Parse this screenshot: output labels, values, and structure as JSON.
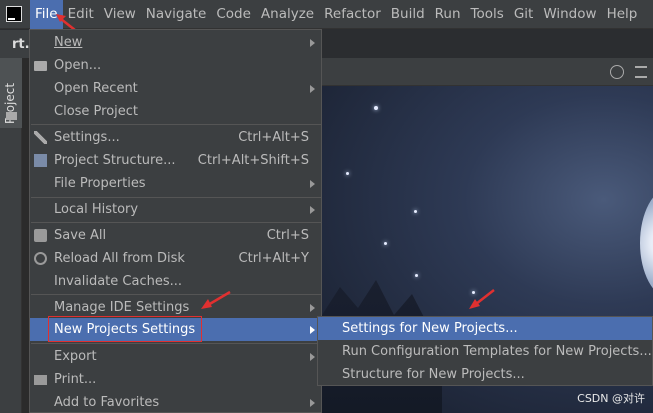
{
  "menubar": {
    "items": [
      {
        "label": "File",
        "mnemonic": "F",
        "active": true
      },
      {
        "label": "Edit"
      },
      {
        "label": "View"
      },
      {
        "label": "Navigate"
      },
      {
        "label": "Code"
      },
      {
        "label": "Analyze"
      },
      {
        "label": "Refactor"
      },
      {
        "label": "Build"
      },
      {
        "label": "Run"
      },
      {
        "label": "Tools"
      },
      {
        "label": "Git"
      },
      {
        "label": "Window"
      },
      {
        "label": "Help"
      }
    ]
  },
  "tab_label": "rt.j",
  "sidebar": {
    "project_tab": "Project"
  },
  "file_menu": {
    "items": [
      {
        "label": "New",
        "shortcut": "",
        "submenu": true,
        "icon": ""
      },
      {
        "label": "Open...",
        "shortcut": "",
        "submenu": false,
        "icon": "folder-icon"
      },
      {
        "label": "Open Recent",
        "shortcut": "",
        "submenu": true,
        "icon": ""
      },
      {
        "label": "Close Project",
        "shortcut": "",
        "submenu": false,
        "icon": ""
      },
      {
        "label": "Settings...",
        "shortcut": "Ctrl+Alt+S",
        "submenu": false,
        "icon": "wrench-icon"
      },
      {
        "label": "Project Structure...",
        "shortcut": "Ctrl+Alt+Shift+S",
        "submenu": false,
        "icon": "project-structure-icon"
      },
      {
        "label": "File Properties",
        "shortcut": "",
        "submenu": true,
        "icon": ""
      },
      {
        "label": "Local History",
        "shortcut": "",
        "submenu": true,
        "icon": ""
      },
      {
        "label": "Save All",
        "shortcut": "Ctrl+S",
        "submenu": false,
        "icon": "save-icon"
      },
      {
        "label": "Reload All from Disk",
        "shortcut": "Ctrl+Alt+Y",
        "submenu": false,
        "icon": "reload-icon"
      },
      {
        "label": "Invalidate Caches...",
        "shortcut": "",
        "submenu": false,
        "icon": ""
      },
      {
        "label": "Manage IDE Settings",
        "shortcut": "",
        "submenu": true,
        "icon": ""
      },
      {
        "label": "New Projects Settings",
        "shortcut": "",
        "submenu": true,
        "icon": "",
        "selected": true
      },
      {
        "label": "Export",
        "shortcut": "",
        "submenu": true,
        "icon": ""
      },
      {
        "label": "Print...",
        "shortcut": "",
        "submenu": false,
        "icon": "print-icon"
      },
      {
        "label": "Add to Favorites",
        "shortcut": "",
        "submenu": true,
        "icon": ""
      }
    ]
  },
  "submenu": {
    "items": [
      {
        "label": "Settings for New Projects...",
        "selected": true
      },
      {
        "label": "Run Configuration Templates for New Projects..."
      },
      {
        "label": "Structure for New Projects..."
      }
    ]
  },
  "watermark": "CSDN @对许",
  "colors": {
    "accent": "#4b6eaf",
    "menu_bg": "#3c3f41",
    "annotation_red": "#e03030"
  }
}
